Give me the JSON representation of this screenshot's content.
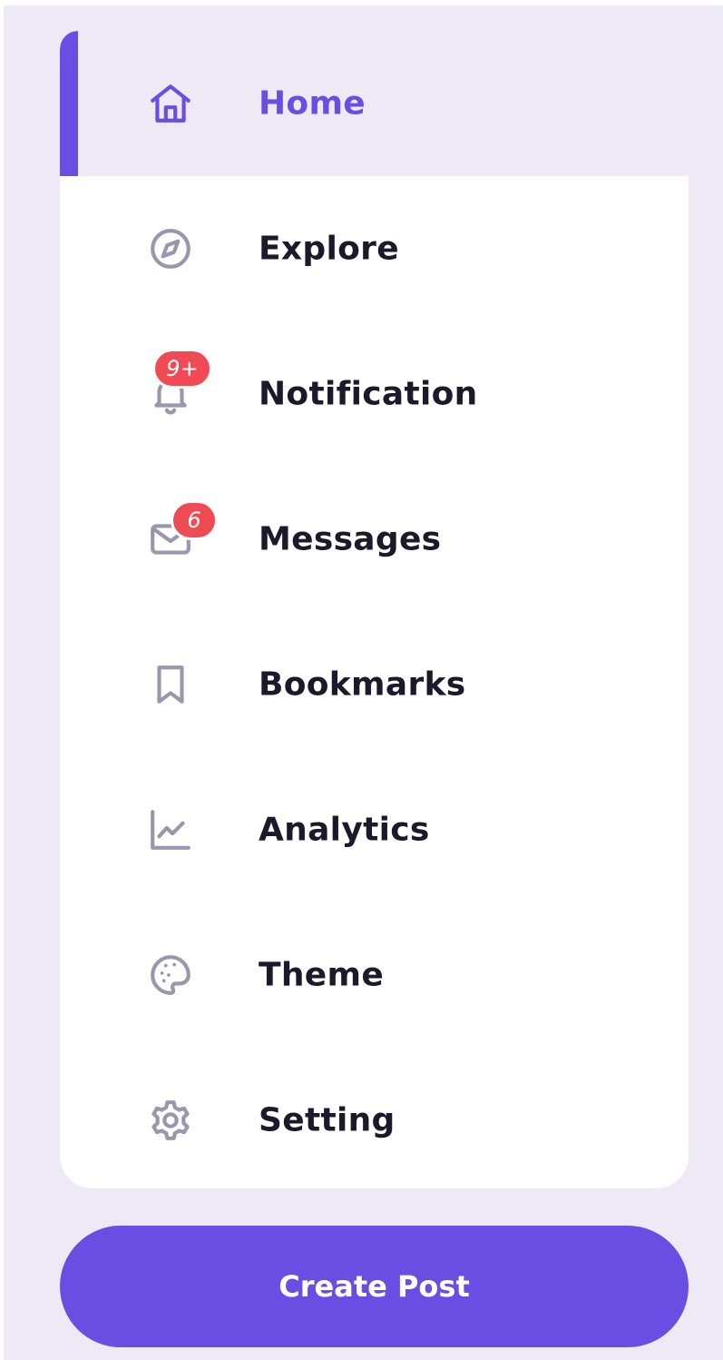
{
  "colors": {
    "accent": "#6a4ee4",
    "icon": "#9a96ad",
    "badge": "#f04a55",
    "background": "#efe9f6",
    "text": "#1c1a2a"
  },
  "menu": {
    "items": [
      {
        "label": "Home",
        "icon": "home-icon",
        "active": true
      },
      {
        "label": "Explore",
        "icon": "compass-icon"
      },
      {
        "label": "Notification",
        "icon": "bell-icon",
        "badge": "9+"
      },
      {
        "label": "Messages",
        "icon": "mail-icon",
        "badge": "6"
      },
      {
        "label": "Bookmarks",
        "icon": "bookmark-icon"
      },
      {
        "label": "Analytics",
        "icon": "chart-line-icon"
      },
      {
        "label": "Theme",
        "icon": "palette-icon"
      },
      {
        "label": "Setting",
        "icon": "gear-icon"
      }
    ]
  },
  "create_post": {
    "label": "Create Post"
  }
}
